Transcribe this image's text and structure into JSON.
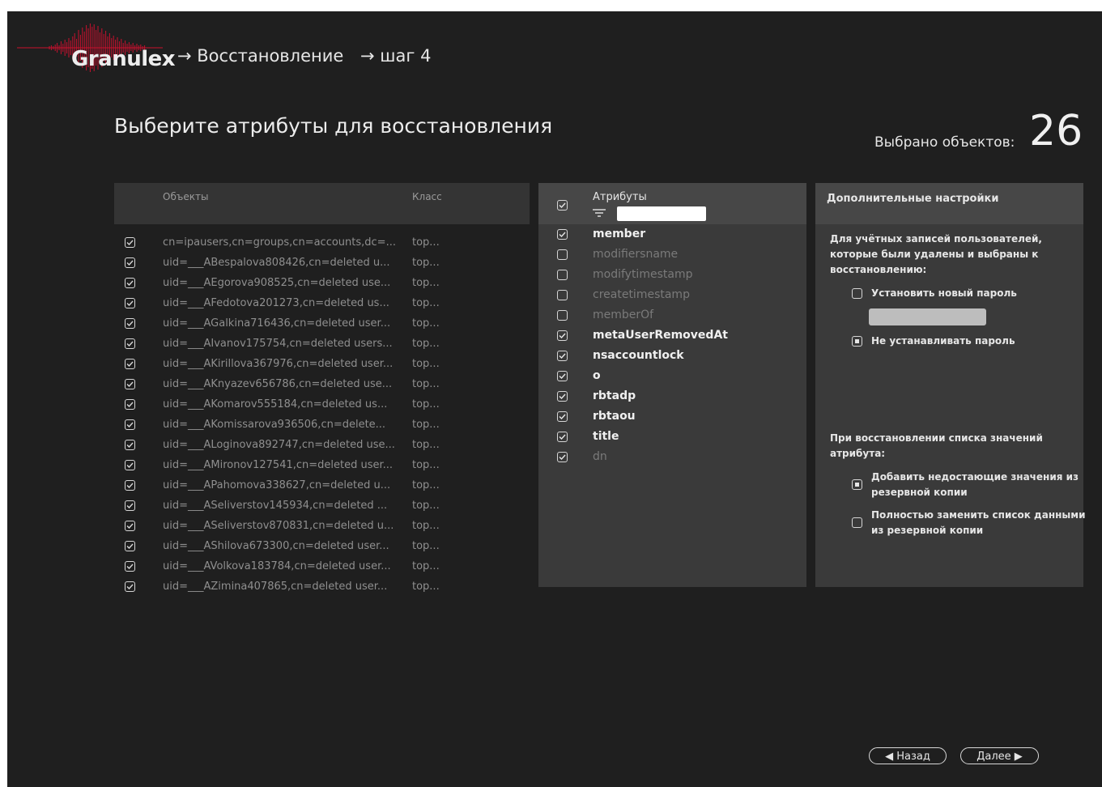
{
  "header": {
    "logo_text": "Granulex",
    "breadcrumb": [
      "→ Восстановление",
      "→ шаг 4"
    ],
    "logo_color": "#c8102e"
  },
  "page": {
    "title": "Выберите атрибуты для восстановления",
    "selected_label": "Выбрано объектов:",
    "selected_count": "26"
  },
  "objects_table": {
    "columns": [
      "Объекты",
      "Класс"
    ],
    "rows": [
      {
        "dn": "cn=ipausers,cn=groups,cn=accounts,dc=...",
        "cls": "top..."
      },
      {
        "dn": "uid=___ABespalova808426,cn=deleted u...",
        "cls": "top..."
      },
      {
        "dn": "uid=___AEgorova908525,cn=deleted use...",
        "cls": "top..."
      },
      {
        "dn": "uid=___AFedotova201273,cn=deleted us...",
        "cls": "top..."
      },
      {
        "dn": "uid=___AGalkina716436,cn=deleted user...",
        "cls": "top..."
      },
      {
        "dn": "uid=___AIvanov175754,cn=deleted users...",
        "cls": "top..."
      },
      {
        "dn": "uid=___AKirillova367976,cn=deleted user...",
        "cls": "top..."
      },
      {
        "dn": "uid=___AKnyazev656786,cn=deleted use...",
        "cls": "top..."
      },
      {
        "dn": "uid=___AKomarov555184,cn=deleted us...",
        "cls": "top..."
      },
      {
        "dn": "uid=___AKomissarova936506,cn=delete...",
        "cls": "top..."
      },
      {
        "dn": "uid=___ALoginova892747,cn=deleted use...",
        "cls": "top..."
      },
      {
        "dn": "uid=___AMironov127541,cn=deleted user...",
        "cls": "top..."
      },
      {
        "dn": "uid=___APahomova338627,cn=deleted u...",
        "cls": "top..."
      },
      {
        "dn": "uid=___ASeliverstov145934,cn=deleted ...",
        "cls": "top..."
      },
      {
        "dn": "uid=___ASeliverstov870831,cn=deleted u...",
        "cls": "top..."
      },
      {
        "dn": "uid=___AShilova673300,cn=deleted user...",
        "cls": "top..."
      },
      {
        "dn": "uid=___AVolkova183784,cn=deleted user...",
        "cls": "top..."
      },
      {
        "dn": "uid=___AZimina407865,cn=deleted user...",
        "cls": "top..."
      }
    ]
  },
  "attributes": {
    "header": "Атрибуты",
    "search_value": "",
    "items": [
      {
        "name": "member",
        "checked": true,
        "dim": false
      },
      {
        "name": "modifiersname",
        "checked": false,
        "dim": true
      },
      {
        "name": "modifytimestamp",
        "checked": false,
        "dim": true
      },
      {
        "name": "createtimestamp",
        "checked": false,
        "dim": true
      },
      {
        "name": "memberOf",
        "checked": false,
        "dim": true
      },
      {
        "name": "metaUserRemovedAt",
        "checked": true,
        "dim": false
      },
      {
        "name": "nsaccountlock",
        "checked": true,
        "dim": false
      },
      {
        "name": "o",
        "checked": true,
        "dim": false
      },
      {
        "name": "rbtadp",
        "checked": true,
        "dim": false
      },
      {
        "name": "rbtaou",
        "checked": true,
        "dim": false
      },
      {
        "name": "title",
        "checked": true,
        "dim": false
      },
      {
        "name": "dn",
        "checked": true,
        "dim": true
      }
    ]
  },
  "settings": {
    "header": "Дополнительные настройки",
    "deleted_users_text": [
      "Для учётных записей пользователей,",
      "которые были удалены и выбраны к",
      "восстановлению:"
    ],
    "opt_new_password": "Установить новый пароль",
    "password_value": "",
    "opt_no_password": "Не устанавливать пароль",
    "list_text": [
      "При восстановлении списка значений",
      "атрибута:"
    ],
    "opt_add_missing": [
      "Добавить недостающие значения из",
      "резервной копии"
    ],
    "opt_replace": [
      "Полностью заменить список данными",
      "из резервной копии"
    ]
  },
  "nav": {
    "back_label": "◀ Назад",
    "next_label": "Далее ▶"
  }
}
